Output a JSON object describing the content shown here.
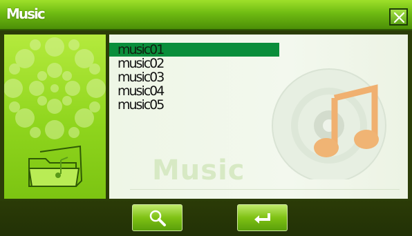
{
  "window": {
    "title": "Music"
  },
  "list": {
    "items": [
      {
        "label": "music01",
        "selected": true
      },
      {
        "label": "music02",
        "selected": false
      },
      {
        "label": "music03",
        "selected": false
      },
      {
        "label": "music04",
        "selected": false
      },
      {
        "label": "music05",
        "selected": false
      }
    ]
  },
  "watermark": {
    "text": "Music"
  },
  "toolbar": {
    "buttons": [
      {
        "name": "search-button",
        "icon": "magnifier-icon"
      },
      {
        "name": "enter-button",
        "icon": "return-arrow-icon"
      }
    ]
  },
  "colors": {
    "title_bar": "#6fbb12",
    "selection": "#0a8e3b",
    "list_background": "#eef6e6",
    "bottom_bar": "#2b3b07"
  }
}
